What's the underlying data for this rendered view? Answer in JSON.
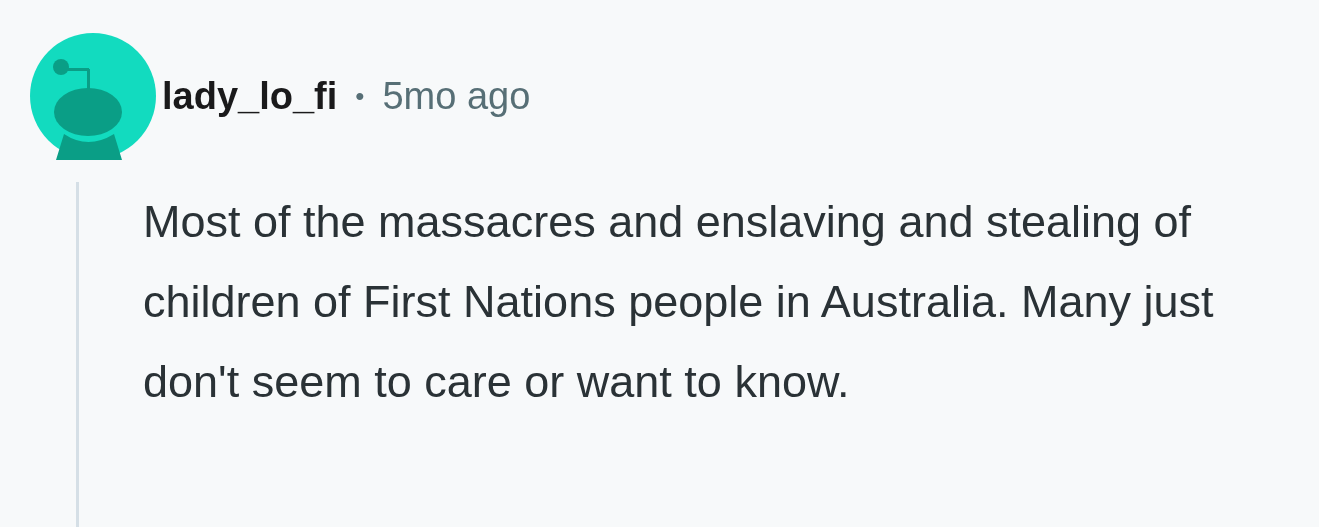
{
  "comment": {
    "author": "lady_lo_fi",
    "separator": "•",
    "time": "5mo ago",
    "body": "Most of the massacres and enslaving and stealing of children of First Nations people in Australia. Many just don't seem to care or want to know."
  }
}
